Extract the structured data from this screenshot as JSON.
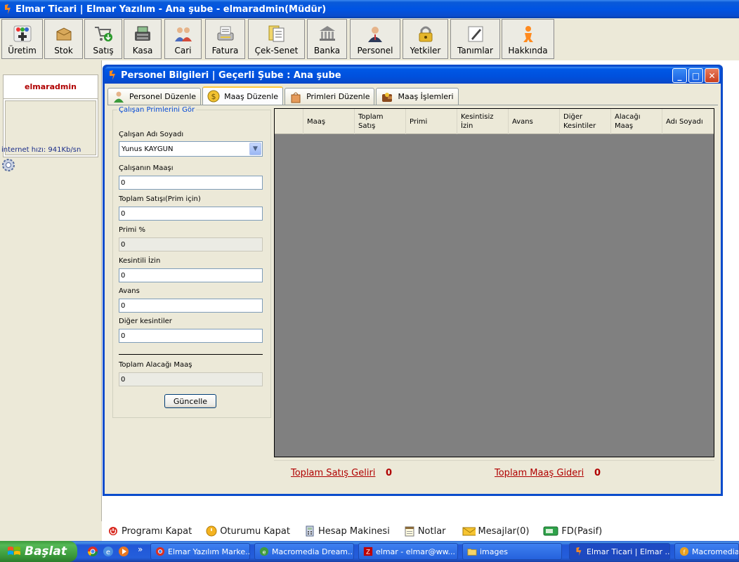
{
  "app": {
    "title": "Elmar Ticari | Elmar Yazılım - Ana şube - elmaradmin(Müdür)"
  },
  "toolbar": {
    "buttons": [
      {
        "label": "Üretim",
        "icon": "production-icon"
      },
      {
        "label": "Stok",
        "icon": "box-icon"
      },
      {
        "label": "Satış",
        "icon": "cart-icon"
      },
      {
        "label": "Kasa",
        "icon": "cash-register-icon"
      },
      {
        "label": "Cari",
        "icon": "people-icon"
      },
      {
        "label": "Fatura",
        "icon": "invoice-printer-icon"
      },
      {
        "label": "Çek-Senet",
        "icon": "documents-icon"
      },
      {
        "label": "Banka",
        "icon": "bank-icon"
      },
      {
        "label": "Personel",
        "icon": "personnel-icon"
      },
      {
        "label": "Yetkiler",
        "icon": "lock-icon"
      },
      {
        "label": "Tanımlar",
        "icon": "pencil-icon"
      },
      {
        "label": "Hakkında",
        "icon": "info-figure-icon"
      }
    ]
  },
  "sidebar": {
    "username": "elmaradmin",
    "internet_speed": "internet hızı: 941Kb/sn"
  },
  "window": {
    "title": "Personel Bilgileri | Geçerli Şube : Ana şube",
    "tabs": [
      {
        "label": "Personel Düzenle",
        "active": false
      },
      {
        "label": "Maaş Düzenle",
        "active": true
      },
      {
        "label": "Primleri Düzenle",
        "active": false
      },
      {
        "label": "Maaş İşlemleri",
        "active": false
      }
    ]
  },
  "form": {
    "group_title": "Çalışan Primlerini Gör",
    "employee_label": "Çalışan Adı Soyadı",
    "employee_value": "Yunus KAYGUN",
    "salary_label": "Çalışanın Maaşı",
    "salary_value": "0",
    "total_sales_label": "Toplam Satışı(Prim için)",
    "total_sales_value": "0",
    "bonus_pct_label": "Primi %",
    "bonus_pct_value": "0",
    "deducted_leave_label": "Kesintili İzin",
    "deducted_leave_value": "0",
    "advance_label": "Avans",
    "advance_value": "0",
    "other_deductions_label": "Diğer kesintiler",
    "other_deductions_value": "0",
    "total_receivable_label": "Toplam Alacağı Maaş",
    "total_receivable_value": "0",
    "update_button": "Güncelle"
  },
  "grid": {
    "columns": [
      "Maaş",
      "Toplam Satış",
      "Primi",
      "Kesintisiz İzin",
      "Avans",
      "Diğer Kesintiler",
      "Alacağı Maaş",
      "Adı Soyadı"
    ],
    "rows": []
  },
  "totals": {
    "sales_label": "Toplam Satış Geliri",
    "sales_value": "0",
    "salary_label": "Toplam Maaş Gideri",
    "salary_value": "0"
  },
  "shortcuts": [
    {
      "label": "Programı Kapat",
      "icon": "power-icon"
    },
    {
      "label": "Oturumu Kapat",
      "icon": "logout-icon"
    },
    {
      "label": "Hesap Makinesi",
      "icon": "calculator-icon"
    },
    {
      "label": "Notlar",
      "icon": "notes-icon"
    },
    {
      "label": "Mesajlar(0)",
      "icon": "envelope-icon"
    },
    {
      "label": "FD(Pasif)",
      "icon": "flash-drive-icon"
    }
  ],
  "taskbar": {
    "start_label": "Başlat",
    "items": [
      {
        "label": "Elmar Yazılım Marke...",
        "icon": "chrome-icon",
        "active": false
      },
      {
        "label": "Macromedia Dream...",
        "icon": "dreamweaver-icon",
        "active": false
      },
      {
        "label": "elmar - elmar@ww...",
        "icon": "filezilla-icon",
        "active": false
      },
      {
        "label": "images",
        "icon": "folder-icon",
        "active": false
      },
      {
        "label": "Elmar Ticari | Elmar ...",
        "icon": "app-icon",
        "active": true
      },
      {
        "label": "Macromedia F",
        "icon": "flash-icon",
        "active": false
      }
    ],
    "overflow": "»"
  },
  "colors": {
    "title_blue": "#0054e3",
    "accent_red": "#b00000",
    "legend_blue": "#0046d5",
    "grid_gray": "#808080"
  }
}
